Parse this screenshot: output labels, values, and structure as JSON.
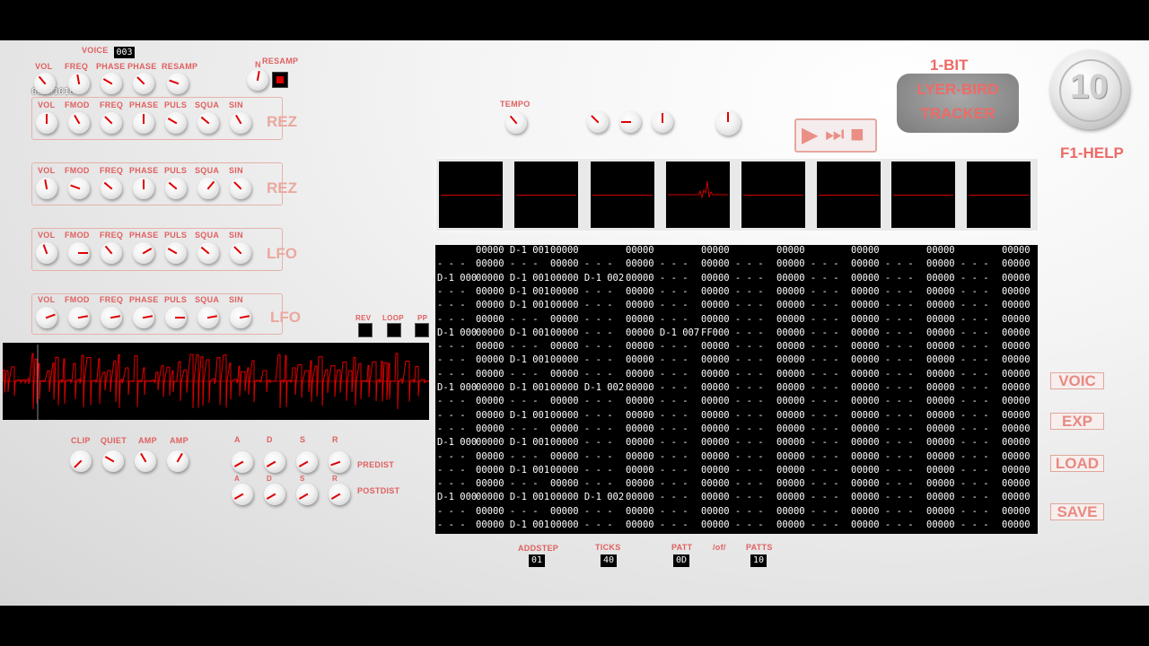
{
  "voice": {
    "label": "VOICE",
    "value": "003"
  },
  "readout": {
    "value": "00001010"
  },
  "resamp": {
    "label_n": "N",
    "label": "RESAMP"
  },
  "top_knobs": {
    "labels": [
      "VOL",
      "FREQ",
      "PHASE",
      "PHASE",
      "RESAMP"
    ]
  },
  "rows": [
    {
      "name": "REZ",
      "labels": [
        "VOL",
        "FMOD",
        "FREQ",
        "PHASE",
        "PULS",
        "SQUA",
        "SIN"
      ]
    },
    {
      "name": "REZ",
      "labels": [
        "VOL",
        "FMOD",
        "FREQ",
        "PHASE",
        "PULS",
        "SQUA",
        "SIN"
      ]
    },
    {
      "name": "LFO",
      "labels": [
        "VOL",
        "FMOD",
        "FREQ",
        "PHASE",
        "PULS",
        "SQUA",
        "SIN"
      ]
    },
    {
      "name": "LFO",
      "labels": [
        "VOL",
        "FMOD",
        "FREQ",
        "PHASE",
        "PULS",
        "SQUA",
        "SIN"
      ]
    }
  ],
  "toggles": {
    "labels": [
      "REV",
      "LOOP",
      "PP"
    ]
  },
  "tempo": {
    "label": "TEMPO"
  },
  "logo": {
    "top": "1-BIT",
    "line1": "LYER-BIRD",
    "line2": "TRACKER",
    "coin": "10"
  },
  "help": {
    "label": "F1-HELP"
  },
  "transport": {
    "play": "▶",
    "step": "⏭",
    "stop": "■"
  },
  "dist": {
    "labels": [
      "CLIP",
      "QUIET",
      "AMP",
      "AMP"
    ]
  },
  "env": {
    "labels": [
      "A",
      "D",
      "S",
      "R"
    ],
    "predist": "PREDIST",
    "postdist": "POSTDIST"
  },
  "side_buttons": {
    "voic": "VOIC",
    "exp": "EXP",
    "load": "LOAD",
    "save": "SAVE"
  },
  "bottom": {
    "addstep_label": "ADDSTEP",
    "addstep": "01",
    "ticks_label": "TICKS",
    "ticks": "40",
    "patt_label": "PATT",
    "patt": "0D",
    "of_label": "/of/",
    "patts_label": "PATTS",
    "patts": "10"
  },
  "pattern_rows": [
    [
      "",
      "00000 D-1 001",
      "00000",
      "00000",
      "00000",
      "00000",
      "00000",
      "00000",
      "00000"
    ],
    [
      "- - -",
      "00000 - - -",
      "00000 - - -",
      "00000 - - -",
      "00000 - - -",
      "00000 - - -",
      "00000 - - -",
      "00000 - - -",
      "00000"
    ],
    [
      "D-1 000",
      "00000 D-1 001",
      "00000 D-1 002",
      "00000 - - -",
      "00000 - - -",
      "00000 - - -",
      "00000 - - -",
      "00000 - - -",
      "00000"
    ],
    [
      "- - -",
      "00000 D-1 001",
      "00000 - - -",
      "00000 - - -",
      "00000 - - -",
      "00000 - - -",
      "00000 - - -",
      "00000 - - -",
      "00000"
    ],
    [
      "- - -",
      "00000 D-1 001",
      "00000 - - -",
      "00000 - - -",
      "00000 - - -",
      "00000 - - -",
      "00000 - - -",
      "00000 - - -",
      "00000"
    ],
    [
      "- - -",
      "00000 - - -",
      "00000 - - -",
      "00000 - - -",
      "00000 - - -",
      "00000 - - -",
      "00000 - - -",
      "00000 - - -",
      "00000"
    ],
    [
      "D-1 000",
      "00000 D-1 001",
      "00000 - - -",
      "00000 D-1 007",
      "FF000 - - -",
      "00000 - - -",
      "00000 - - -",
      "00000 - - -",
      "00000"
    ],
    [
      "- - -",
      "00000 - - -",
      "00000 - - -",
      "00000 - - -",
      "00000 - - -",
      "00000 - - -",
      "00000 - - -",
      "00000 - - -",
      "00000"
    ],
    [
      "- - -",
      "00000 D-1 001",
      "00000 - - -",
      "00000 - - -",
      "00000 - - -",
      "00000 - - -",
      "00000 - - -",
      "00000 - - -",
      "00000"
    ],
    [
      "- - -",
      "00000 - - -",
      "00000 - - -",
      "00000 - - -",
      "00000 - - -",
      "00000 - - -",
      "00000 - - -",
      "00000 - - -",
      "00000"
    ],
    [
      "D-1 000",
      "00000 D-1 001",
      "00000 D-1 002",
      "00000 - - -",
      "00000 - - -",
      "00000 - - -",
      "00000 - - -",
      "00000 - - -",
      "00000"
    ],
    [
      "- - -",
      "00000 - - -",
      "00000 - - -",
      "00000 - - -",
      "00000 - - -",
      "00000 - - -",
      "00000 - - -",
      "00000 - - -",
      "00000"
    ],
    [
      "- - -",
      "00000 D-1 001",
      "00000 - - -",
      "00000 - - -",
      "00000 - - -",
      "00000 - - -",
      "00000 - - -",
      "00000 - - -",
      "00000"
    ],
    [
      "- - -",
      "00000 - - -",
      "00000 - - -",
      "00000 - - -",
      "00000 - - -",
      "00000 - - -",
      "00000 - - -",
      "00000 - - -",
      "00000"
    ],
    [
      "D-1 000",
      "00000 D-1 001",
      "00000 - - -",
      "00000 - - -",
      "00000 - - -",
      "00000 - - -",
      "00000 - - -",
      "00000 - - -",
      "00000"
    ],
    [
      "- - -",
      "00000 - - -",
      "00000 - - -",
      "00000 - - -",
      "00000 - - -",
      "00000 - - -",
      "00000 - - -",
      "00000 - - -",
      "00000"
    ],
    [
      "- - -",
      "00000 D-1 001",
      "00000 - - -",
      "00000 - - -",
      "00000 - - -",
      "00000 - - -",
      "00000 - - -",
      "00000 - - -",
      "00000"
    ],
    [
      "- - -",
      "00000 - - -",
      "00000 - - -",
      "00000 - - -",
      "00000 - - -",
      "00000 - - -",
      "00000 - - -",
      "00000 - - -",
      "00000"
    ],
    [
      "D-1 000",
      "00000 D-1 001",
      "00000 D-1 002",
      "00000 - - -",
      "00000 - - -",
      "00000 - - -",
      "00000 - - -",
      "00000 - - -",
      "00000"
    ],
    [
      "- - -",
      "00000 - - -",
      "00000 - - -",
      "00000 - - -",
      "00000 - - -",
      "00000 - - -",
      "00000 - - -",
      "00000 - - -",
      "00000"
    ],
    [
      "- - -",
      "00000 D-1 001",
      "00000 - - -",
      "00000 - - -",
      "00000 - - -",
      "00000 - - -",
      "00000 - - -",
      "00000 - - -",
      "00000"
    ]
  ],
  "colors": {
    "accent": "#e06060",
    "indicator": "#e00000",
    "scope_line": "#d00000"
  }
}
